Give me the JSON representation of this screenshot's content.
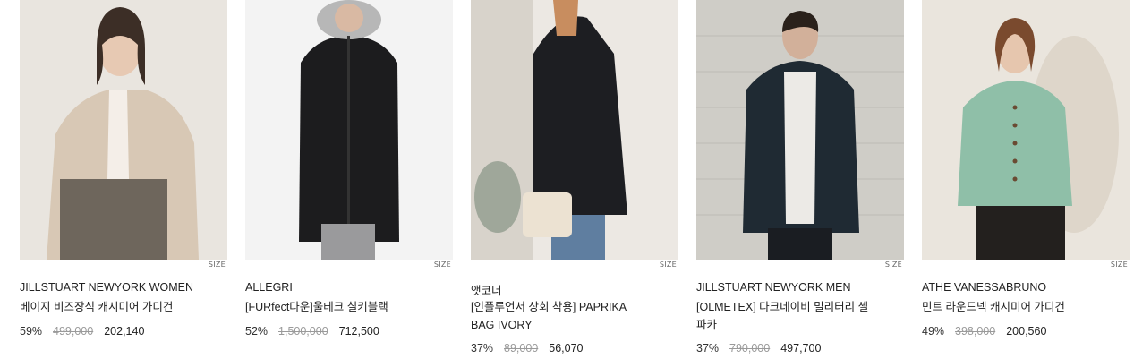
{
  "size_label": "SIZE",
  "products": [
    {
      "brand": "JILLSTUART NEWYORK WOMEN",
      "name": "베이지 비즈장식 캐시미어 가디건",
      "discount": "59%",
      "original_price": "499,000",
      "sale_price": "202,140"
    },
    {
      "brand": "ALLEGRI",
      "name": "[FURfect다운]울테크 실키블랙",
      "discount": "52%",
      "original_price": "1,500,000",
      "sale_price": "712,500"
    },
    {
      "brand": "앳코너",
      "name": "[인플루언서 상회 착용] PAPRIKA BAG IVORY",
      "discount": "37%",
      "original_price": "89,000",
      "sale_price": "56,070"
    },
    {
      "brand": "JILLSTUART NEWYORK MEN",
      "name": "[OLMETEX] 다크네이비 밀리터리 셸파카",
      "discount": "37%",
      "original_price": "790,000",
      "sale_price": "497,700"
    },
    {
      "brand": "ATHE VANESSABRUNO",
      "name": "민트 라운드넥 캐시미어 가디건",
      "discount": "49%",
      "original_price": "398,000",
      "sale_price": "200,560"
    }
  ],
  "colors": {
    "card1_bg": "#e8e4df",
    "card1_garment": "#d9c9b6",
    "card2_bg": "#f2f2f2",
    "card2_garment": "#1b1b1d",
    "card3_bg": "#ebe7e2",
    "card3_garment": "#1d1e22",
    "card4_bg": "#cfcdc7",
    "card4_garment": "#1f2a33",
    "card5_bg": "#e9e4dc",
    "card5_garment": "#8fbfa8"
  }
}
